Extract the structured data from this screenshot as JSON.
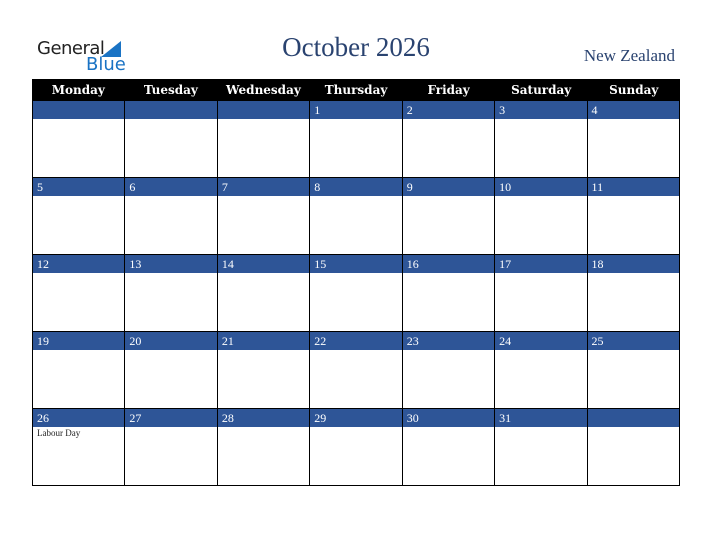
{
  "logo": {
    "general": "General",
    "blue": "Blue"
  },
  "title": "October 2026",
  "country": "New Zealand",
  "days": [
    "Monday",
    "Tuesday",
    "Wednesday",
    "Thursday",
    "Friday",
    "Saturday",
    "Sunday"
  ],
  "weeks": [
    [
      {
        "d": ""
      },
      {
        "d": ""
      },
      {
        "d": ""
      },
      {
        "d": "1"
      },
      {
        "d": "2"
      },
      {
        "d": "3"
      },
      {
        "d": "4"
      }
    ],
    [
      {
        "d": "5"
      },
      {
        "d": "6"
      },
      {
        "d": "7"
      },
      {
        "d": "8"
      },
      {
        "d": "9"
      },
      {
        "d": "10"
      },
      {
        "d": "11"
      }
    ],
    [
      {
        "d": "12"
      },
      {
        "d": "13"
      },
      {
        "d": "14"
      },
      {
        "d": "15"
      },
      {
        "d": "16"
      },
      {
        "d": "17"
      },
      {
        "d": "18"
      }
    ],
    [
      {
        "d": "19"
      },
      {
        "d": "20"
      },
      {
        "d": "21"
      },
      {
        "d": "22"
      },
      {
        "d": "23"
      },
      {
        "d": "24"
      },
      {
        "d": "25"
      }
    ],
    [
      {
        "d": "26",
        "e": "Labour Day"
      },
      {
        "d": "27"
      },
      {
        "d": "28"
      },
      {
        "d": "29"
      },
      {
        "d": "30"
      },
      {
        "d": "31"
      },
      {
        "d": ""
      }
    ]
  ],
  "colors": {
    "band": "#2e5597",
    "title": "#2a4370",
    "logo_blue": "#1a73c4"
  }
}
